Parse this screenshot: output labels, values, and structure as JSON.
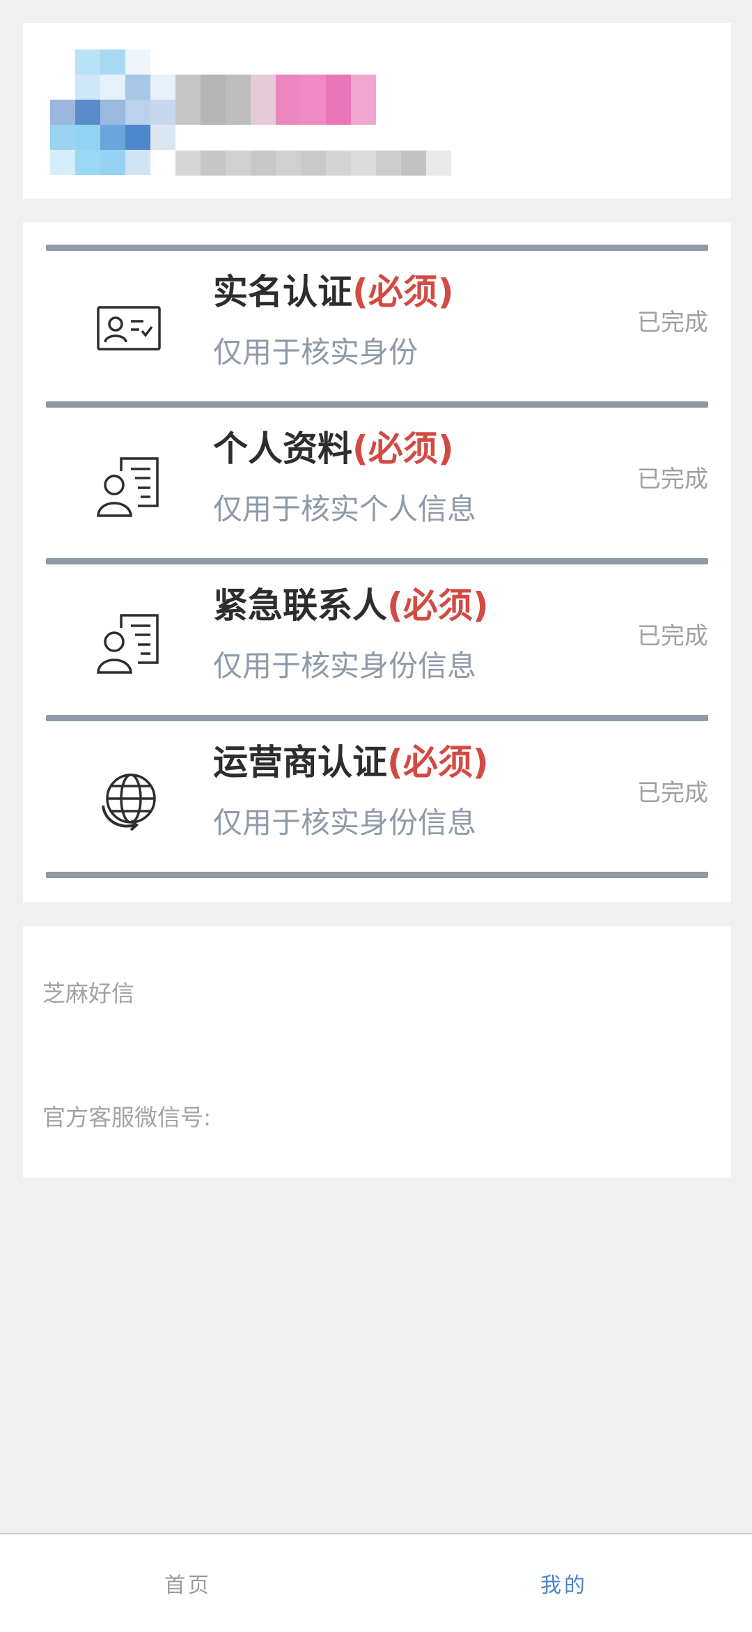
{
  "verification": {
    "items": [
      {
        "title": "实名认证",
        "required": "(必须)",
        "subtitle": "仅用于核实身份",
        "status": "已完成",
        "icon": "id-card-icon"
      },
      {
        "title": "个人资料",
        "required": "(必须)",
        "subtitle": "仅用于核实个人信息",
        "status": "已完成",
        "icon": "profile-document-icon"
      },
      {
        "title": "紧急联系人",
        "required": "(必须)",
        "subtitle": "仅用于核实身份信息",
        "status": "已完成",
        "icon": "contact-document-icon"
      },
      {
        "title": "运营商认证",
        "required": "(必须)",
        "subtitle": "仅用于核实身份信息",
        "status": "已完成",
        "icon": "globe-refresh-icon"
      }
    ]
  },
  "info": {
    "app_name": "芝麻好信",
    "service_wechat": "官方客服微信号:"
  },
  "tabbar": {
    "home": "首页",
    "mine": "我的",
    "active_color": "#4a86c8"
  },
  "colors": {
    "required": "#d24a43",
    "divider": "#8e9aa5",
    "status": "#a0a0a0"
  }
}
